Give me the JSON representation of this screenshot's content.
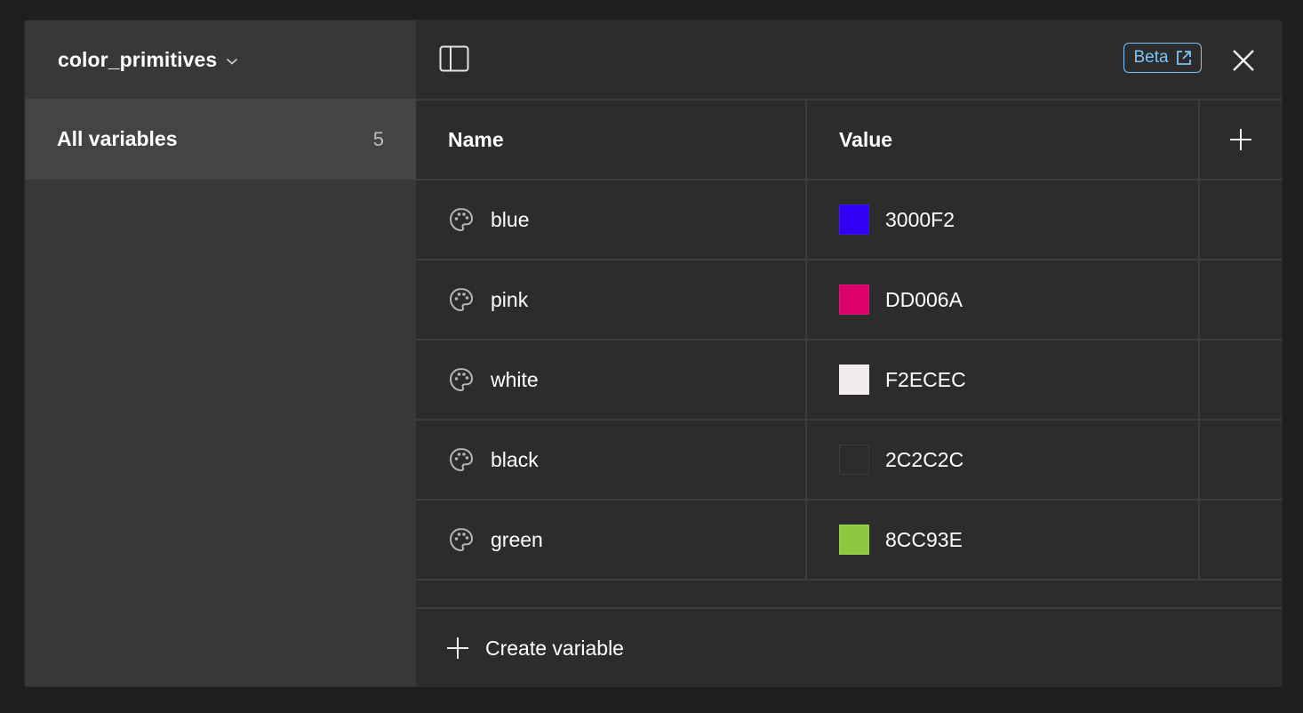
{
  "sidebar": {
    "collection_name": "color_primitives",
    "items": [
      {
        "label": "All variables",
        "count": "5"
      }
    ]
  },
  "toolbar": {
    "beta_label": "Beta",
    "accent_color": "#7cc4f8"
  },
  "table": {
    "columns": {
      "name": "Name",
      "value": "Value"
    },
    "rows": [
      {
        "name": "blue",
        "value": "3000F2",
        "color": "#3000F2"
      },
      {
        "name": "pink",
        "value": "DD006A",
        "color": "#DD006A"
      },
      {
        "name": "white",
        "value": "F2ECEC",
        "color": "#F2ECEC"
      },
      {
        "name": "black",
        "value": "2C2C2C",
        "color": "#2C2C2C"
      },
      {
        "name": "green",
        "value": "8CC93E",
        "color": "#8CC93E"
      }
    ]
  },
  "footer": {
    "create_label": "Create variable"
  },
  "icons": {
    "variable_type": "palette-icon",
    "sidebar_toggle": "sidebar-toggle-icon",
    "close": "close-icon",
    "add": "plus-icon",
    "external": "external-link-icon",
    "dropdown": "chevron-down-icon"
  }
}
